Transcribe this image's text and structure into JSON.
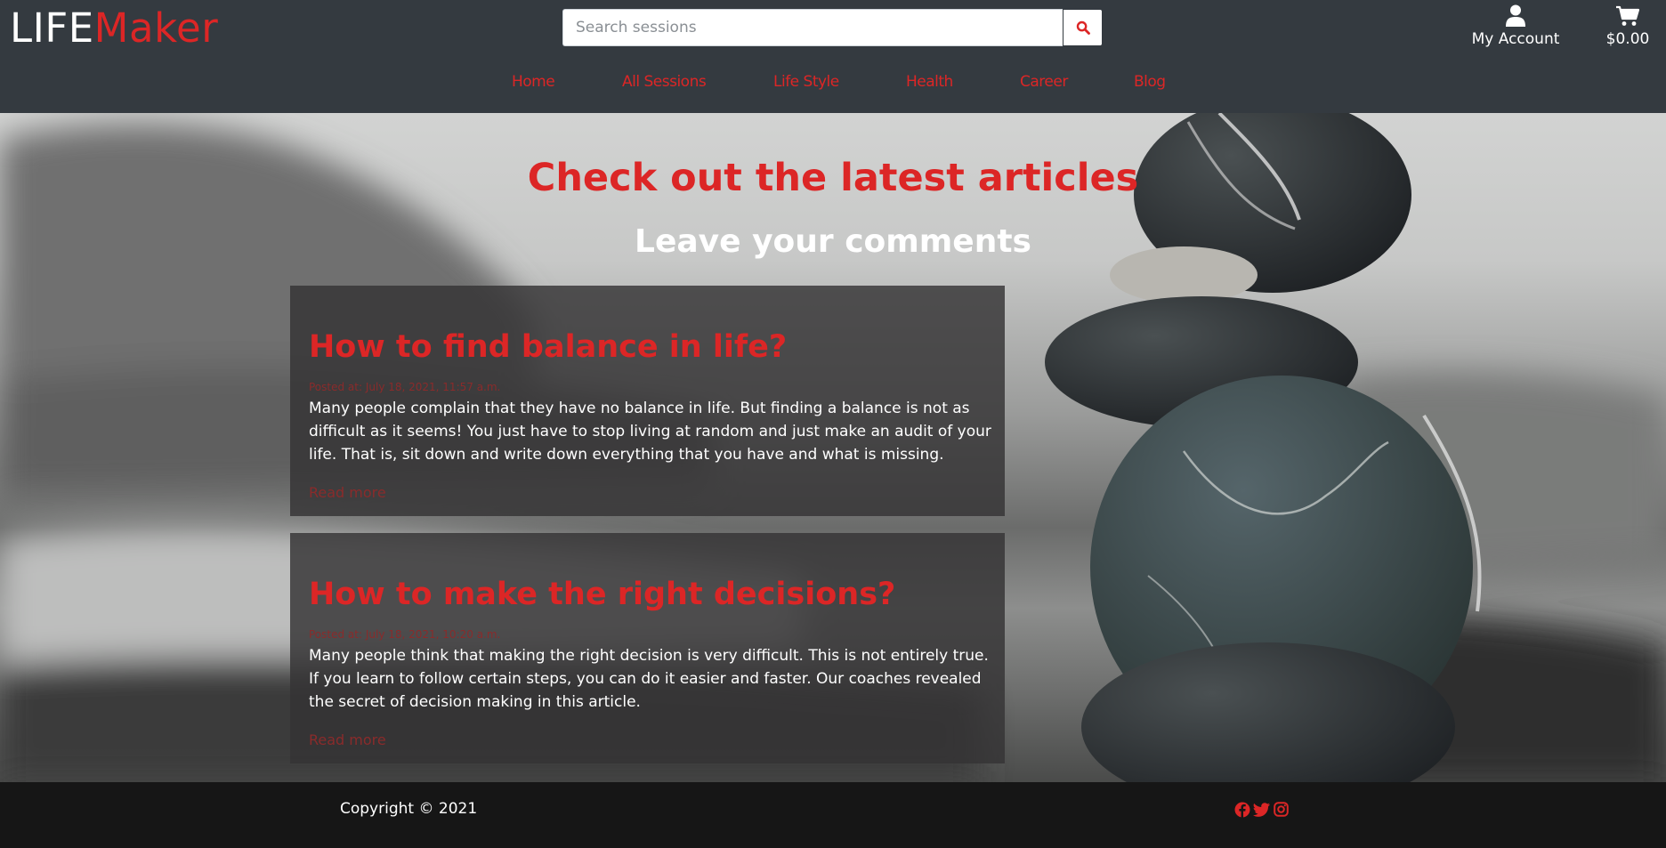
{
  "brand": {
    "part1": "LIFE",
    "part2": "Maker"
  },
  "search": {
    "placeholder": "Search sessions",
    "value": ""
  },
  "account": {
    "label": "My Account"
  },
  "cart": {
    "total": "$0.00"
  },
  "nav": {
    "items": [
      {
        "label": "Home"
      },
      {
        "label": "All Sessions"
      },
      {
        "label": "Life Style"
      },
      {
        "label": "Health"
      },
      {
        "label": "Career"
      },
      {
        "label": "Blog"
      }
    ]
  },
  "hero": {
    "title": "Check out the latest articles",
    "subtitle": "Leave your comments"
  },
  "articles": [
    {
      "title": "How to find balance in life?",
      "date": "Posted at: July 18, 2021, 11:57 a.m.",
      "excerpt": "Many people complain that they have no balance in life. But finding a balance is not as difficult as it seems! You just have to stop living at random and just make an audit of your life. That is, sit down and write down everything that you have and what is missing.",
      "link": "Read more"
    },
    {
      "title": "How to make the right decisions?",
      "date": "Posted at: July 18, 2021, 10:20 a.m.",
      "excerpt": "Many people think that making the right decision is very difficult. This is not entirely true. If you learn to follow certain steps, you can do it easier and faster. Our coaches revealed the secret of decision making in this article.",
      "link": "Read more"
    }
  ],
  "footer": {
    "copyright": "Copyright © 2021"
  },
  "icons": {
    "search": "search-icon",
    "account": "user-icon",
    "cart": "shopping-cart-icon",
    "social": [
      "facebook-icon",
      "twitter-icon",
      "instagram-icon"
    ]
  },
  "colors": {
    "accent": "#dc2626",
    "header_bg": "#343a40",
    "footer_bg": "#161616",
    "card_bg": "#343334"
  }
}
